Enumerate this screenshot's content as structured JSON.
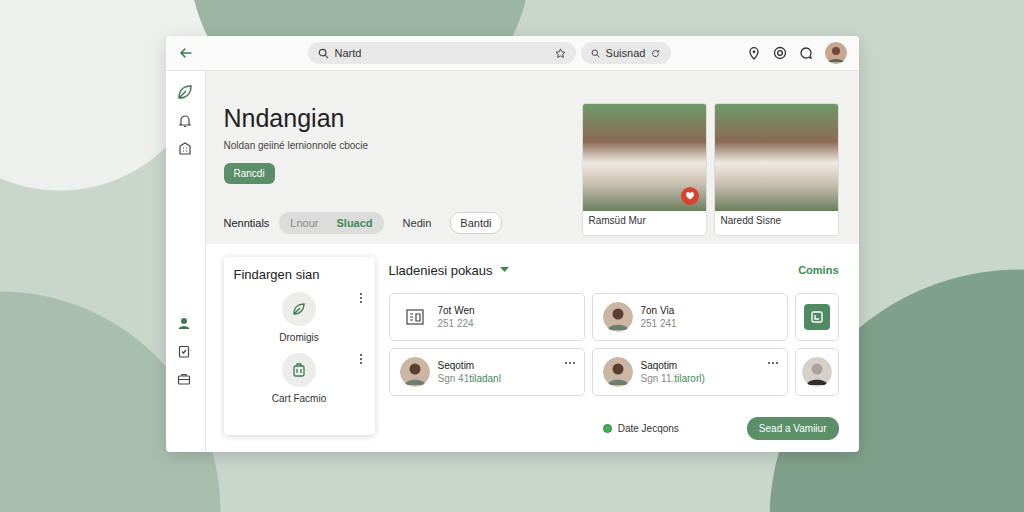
{
  "toolbar": {
    "search": "Nartd",
    "secondary_search": "Suisnad"
  },
  "hero": {
    "title": "Nndangian",
    "subtitle": "Noldan geiiné lernionnole cbocie",
    "button": "Rancdi"
  },
  "tabs_label": "Nenntials",
  "tabs": [
    {
      "label": "Lnour",
      "selected": false,
      "kind": "segment"
    },
    {
      "label": "Sluacd",
      "selected": true,
      "kind": "segment"
    },
    {
      "label": "Nedin",
      "selected": false,
      "kind": "plain"
    },
    {
      "label": "Bantdi",
      "selected": false,
      "kind": "outline"
    }
  ],
  "listings": [
    {
      "caption": "Ramsüd Mur",
      "favorite": true
    },
    {
      "caption": "Naredd Sisne",
      "favorite": false
    }
  ],
  "side_card": {
    "title": "Findargen sian",
    "items": [
      {
        "label": "Dromigis",
        "kind": "leaf"
      },
      {
        "label": "Cart Facmio",
        "kind": "luggage"
      }
    ]
  },
  "contacts": {
    "title": "Lladeniesi pokaus",
    "expanded": true,
    "link": "Comins",
    "items": [
      {
        "kind": "icon",
        "name": "7ot Wen",
        "detail": "251 224",
        "tag": "",
        "menu": false
      },
      {
        "kind": "avatar",
        "name": "7on Via",
        "detail": "251 241",
        "tag": "",
        "menu": false
      },
      {
        "kind": "tile-icon",
        "name": "",
        "detail": "",
        "tag": "",
        "menu": false
      },
      {
        "kind": "avatar",
        "name": "Seqotim",
        "detail": "Sgn 41",
        "tag": "tiladanl",
        "menu": true
      },
      {
        "kind": "avatar",
        "name": "Saqotim",
        "detail": "Sgn 11.",
        "tag": "tilarorl)",
        "menu": true
      },
      {
        "kind": "tile-avatar",
        "name": "",
        "detail": "",
        "tag": "",
        "menu": false
      }
    ]
  },
  "footer": {
    "status": "Date Jecqons",
    "status_on": true,
    "button": "Sead a Vamiiur"
  }
}
